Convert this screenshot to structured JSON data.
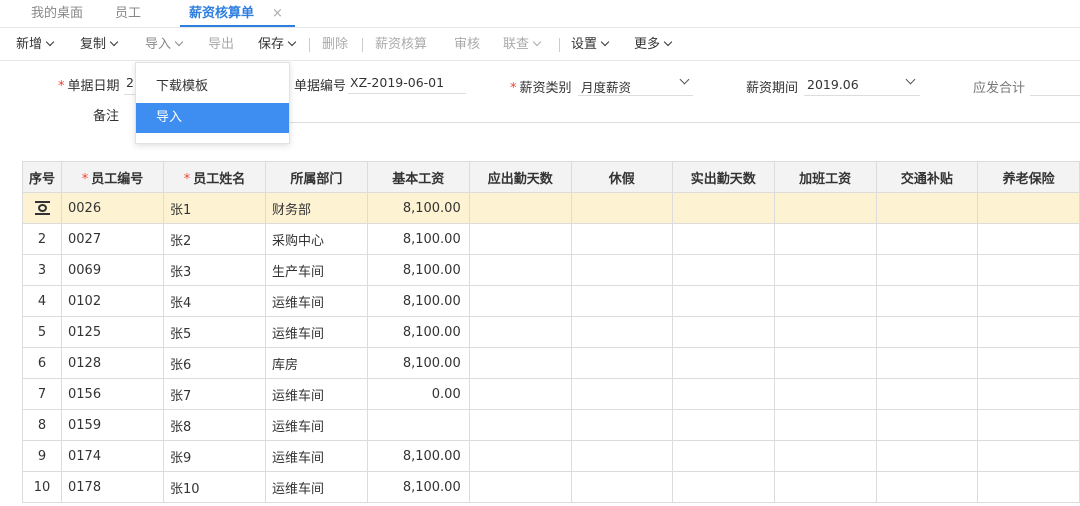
{
  "tabs": [
    {
      "label": "我的桌面"
    },
    {
      "label": "员工"
    },
    {
      "label": "薪资核算单"
    }
  ],
  "tab_close": "×",
  "toolbar": {
    "add": "新增",
    "copy": "复制",
    "import": "导入",
    "export": "导出",
    "save": "保存",
    "delete": "删除",
    "payroll_check": "薪资核算",
    "audit": "审核",
    "link_query": "联查",
    "settings": "设置",
    "more": "更多"
  },
  "import_menu": {
    "items": [
      {
        "label": "下载模板"
      },
      {
        "label": "导入"
      }
    ]
  },
  "form": {
    "date_label": "单据日期",
    "date_value": "2",
    "doc_no_label": "单据编号",
    "doc_no_value": "XZ-2019-06-01",
    "salary_type_label": "薪资类别",
    "salary_type_value": "月度薪资",
    "period_label": "薪资期间",
    "period_value": "2019.06",
    "total_label": "应发合计",
    "remark_label": "备注"
  },
  "table": {
    "headers": [
      "序号",
      "员工编号",
      "员工姓名",
      "所属部门",
      "基本工资",
      "应出勤天数",
      "休假",
      "实出勤天数",
      "加班工资",
      "交通补贴",
      "养老保险"
    ],
    "rows": [
      {
        "idx": "",
        "code": "0026",
        "name": "张1",
        "dept": "财务部",
        "salary": "8,100.00"
      },
      {
        "idx": "2",
        "code": "0027",
        "name": "张2",
        "dept": "采购中心",
        "salary": "8,100.00"
      },
      {
        "idx": "3",
        "code": "0069",
        "name": "张3",
        "dept": "生产车间",
        "salary": "8,100.00"
      },
      {
        "idx": "4",
        "code": "0102",
        "name": "张4",
        "dept": "运维车间",
        "salary": "8,100.00"
      },
      {
        "idx": "5",
        "code": "0125",
        "name": "张5",
        "dept": "运维车间",
        "salary": "8,100.00"
      },
      {
        "idx": "6",
        "code": "0128",
        "name": "张6",
        "dept": "库房",
        "salary": "8,100.00"
      },
      {
        "idx": "7",
        "code": "0156",
        "name": "张7",
        "dept": "运维车间",
        "salary": "0.00"
      },
      {
        "idx": "8",
        "code": "0159",
        "name": "张8",
        "dept": "运维车间",
        "salary": ""
      },
      {
        "idx": "9",
        "code": "0174",
        "name": "张9",
        "dept": "运维车间",
        "salary": "8,100.00"
      },
      {
        "idx": "10",
        "code": "0178",
        "name": "张10",
        "dept": "运维车间",
        "salary": "8,100.00"
      }
    ]
  },
  "colors": {
    "accent": "#2f7fe0",
    "menu_active": "#3d8ef0",
    "selected_row": "#fdf3d3",
    "required": "#e43333"
  }
}
